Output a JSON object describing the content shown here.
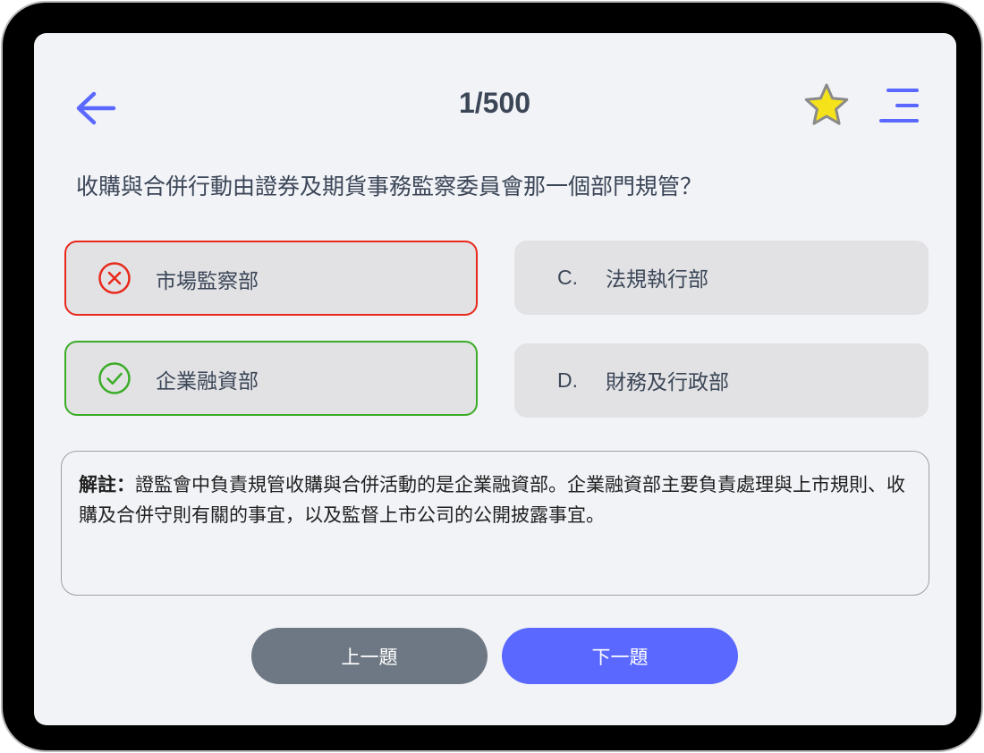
{
  "header": {
    "counter": "1/500",
    "icons": {
      "back": "arrow-left-icon",
      "favorite": "star-icon",
      "menu": "menu-icon"
    }
  },
  "question": {
    "text": "收購與合併行動由證券及期貨事務監察委員會那一個部門規管？"
  },
  "options": [
    {
      "id": "a",
      "letter": "",
      "label": "市場監察部",
      "state": "wrong",
      "icon": "x-circle-icon"
    },
    {
      "id": "b",
      "letter": "",
      "label": "企業融資部",
      "state": "correct",
      "icon": "check-circle-icon"
    },
    {
      "id": "c",
      "letter": "C.",
      "label": "法規執行部",
      "state": "neutral"
    },
    {
      "id": "d",
      "letter": "D.",
      "label": "財務及行政部",
      "state": "neutral"
    }
  ],
  "explanation": {
    "label": "解註：",
    "text": "證監會中負責規管收購與合併活動的是企業融資部。企業融資部主要負責處理與上市規則、收購及合併守則有關的事宜，以及監督上市公司的公開披露事宜。"
  },
  "buttons": {
    "prev": "上一題",
    "next": "下一題"
  },
  "colors": {
    "accent": "#5a68ff",
    "wrong": "#e8281a",
    "correct": "#3aac26",
    "star": "#f5e21a",
    "prev_button": "#6e7884"
  }
}
